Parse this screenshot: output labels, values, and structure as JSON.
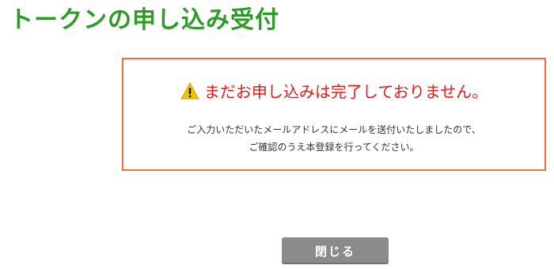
{
  "page": {
    "title": "トークンの申し込み受付"
  },
  "notice": {
    "icon": "warning-icon",
    "heading": "まだお申し込みは完了しておりません。",
    "message_line1": "ご入力いただいたメールアドレスにメールを送付いたしましたので、",
    "message_line2": "ご確認のうえ本登録を行ってください。",
    "border_color": "#ed6f3a",
    "heading_color": "#e61919"
  },
  "actions": {
    "close_label": "閉じる"
  },
  "colors": {
    "title": "#2e9b26",
    "button": "#8b8b8b"
  }
}
